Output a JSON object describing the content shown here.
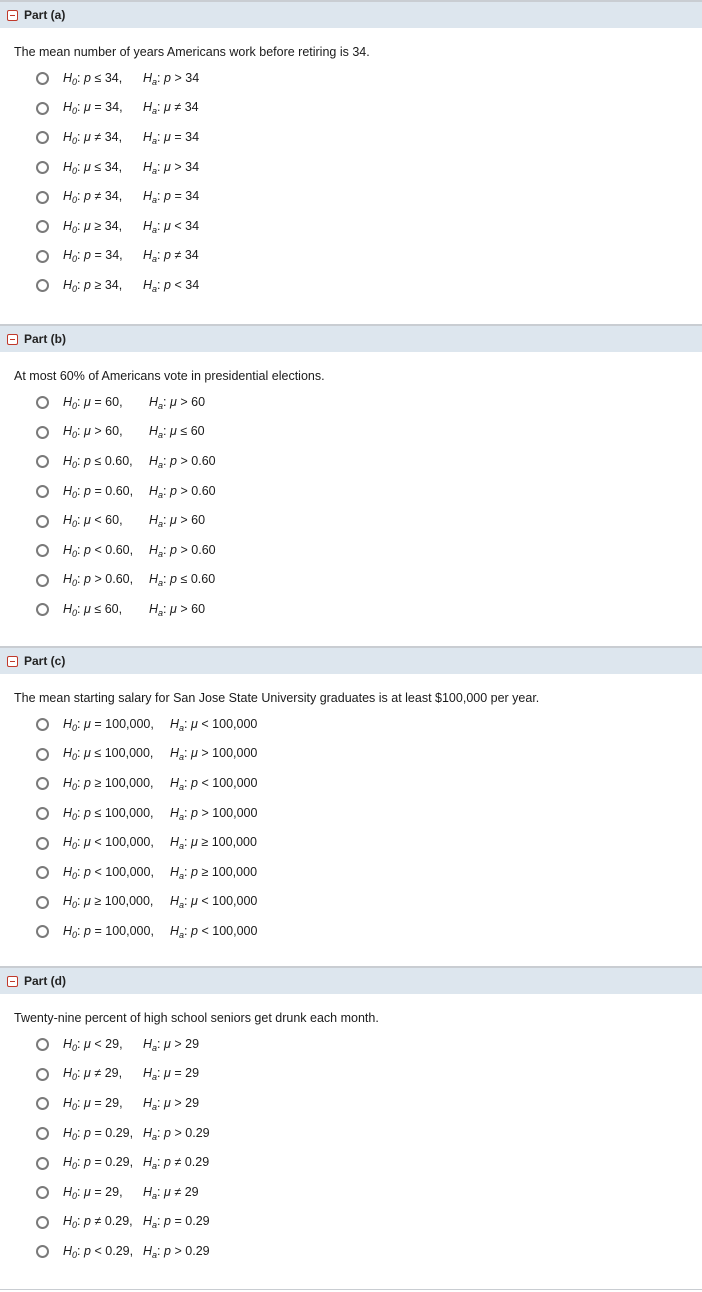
{
  "parts": [
    {
      "label": "Part (a)",
      "question": "The mean number of years Americans work before retiring is 34.",
      "options": [
        {
          "h0": "p ≤ 34,",
          "ha": "p > 34"
        },
        {
          "h0": "μ = 34,",
          "ha": "μ ≠ 34"
        },
        {
          "h0": "μ ≠ 34,",
          "ha": "μ = 34"
        },
        {
          "h0": "μ ≤ 34,",
          "ha": "μ > 34"
        },
        {
          "h0": "p ≠ 34,",
          "ha": "p = 34"
        },
        {
          "h0": "μ ≥ 34,",
          "ha": "μ < 34"
        },
        {
          "h0": "p = 34,",
          "ha": "p ≠ 34"
        },
        {
          "h0": "p ≥ 34,",
          "ha": "p < 34"
        }
      ]
    },
    {
      "label": "Part (b)",
      "question": "At most 60% of Americans vote in presidential elections.",
      "options": [
        {
          "h0": "μ = 60,",
          "ha": "μ > 60"
        },
        {
          "h0": "μ > 60,",
          "ha": "μ ≤ 60"
        },
        {
          "h0": "p ≤ 0.60,",
          "ha": "p > 0.60"
        },
        {
          "h0": "p = 0.60,",
          "ha": "p > 0.60"
        },
        {
          "h0": "μ < 60,",
          "ha": "μ > 60"
        },
        {
          "h0": "p < 0.60,",
          "ha": "p > 0.60"
        },
        {
          "h0": "p > 0.60,",
          "ha": "p ≤ 0.60"
        },
        {
          "h0": "μ ≤ 60,",
          "ha": "μ > 60"
        }
      ]
    },
    {
      "label": "Part (c)",
      "question": "The mean starting salary for San Jose State University graduates is at least $100,000 per year.",
      "options": [
        {
          "h0": "μ = 100,000,",
          "ha": "μ < 100,000"
        },
        {
          "h0": "μ ≤ 100,000,",
          "ha": "μ > 100,000"
        },
        {
          "h0": "p ≥ 100,000,",
          "ha": "p < 100,000"
        },
        {
          "h0": "p ≤ 100,000,",
          "ha": "p > 100,000"
        },
        {
          "h0": "μ < 100,000,",
          "ha": "μ ≥ 100,000"
        },
        {
          "h0": "p < 100,000,",
          "ha": "p ≥ 100,000"
        },
        {
          "h0": "μ ≥ 100,000,",
          "ha": "μ < 100,000"
        },
        {
          "h0": "p = 100,000,",
          "ha": "p < 100,000"
        }
      ]
    },
    {
      "label": "Part (d)",
      "question": "Twenty-nine percent of high school seniors get drunk each month.",
      "options": [
        {
          "h0": "μ < 29,",
          "ha": "μ > 29"
        },
        {
          "h0": "μ ≠ 29,",
          "ha": "μ = 29"
        },
        {
          "h0": "μ = 29,",
          "ha": "μ > 29"
        },
        {
          "h0": "p = 0.29,",
          "ha": "p > 0.29"
        },
        {
          "h0": "p = 0.29,",
          "ha": "p ≠ 0.29"
        },
        {
          "h0": "μ = 29,",
          "ha": "μ ≠ 29"
        },
        {
          "h0": "p ≠ 0.29,",
          "ha": "p = 0.29"
        },
        {
          "h0": "p < 0.29,",
          "ha": "p > 0.29"
        }
      ]
    }
  ],
  "labels": {
    "h": "H",
    "h0_sub": "0",
    "ha_sub": "a",
    "colon": ":"
  }
}
